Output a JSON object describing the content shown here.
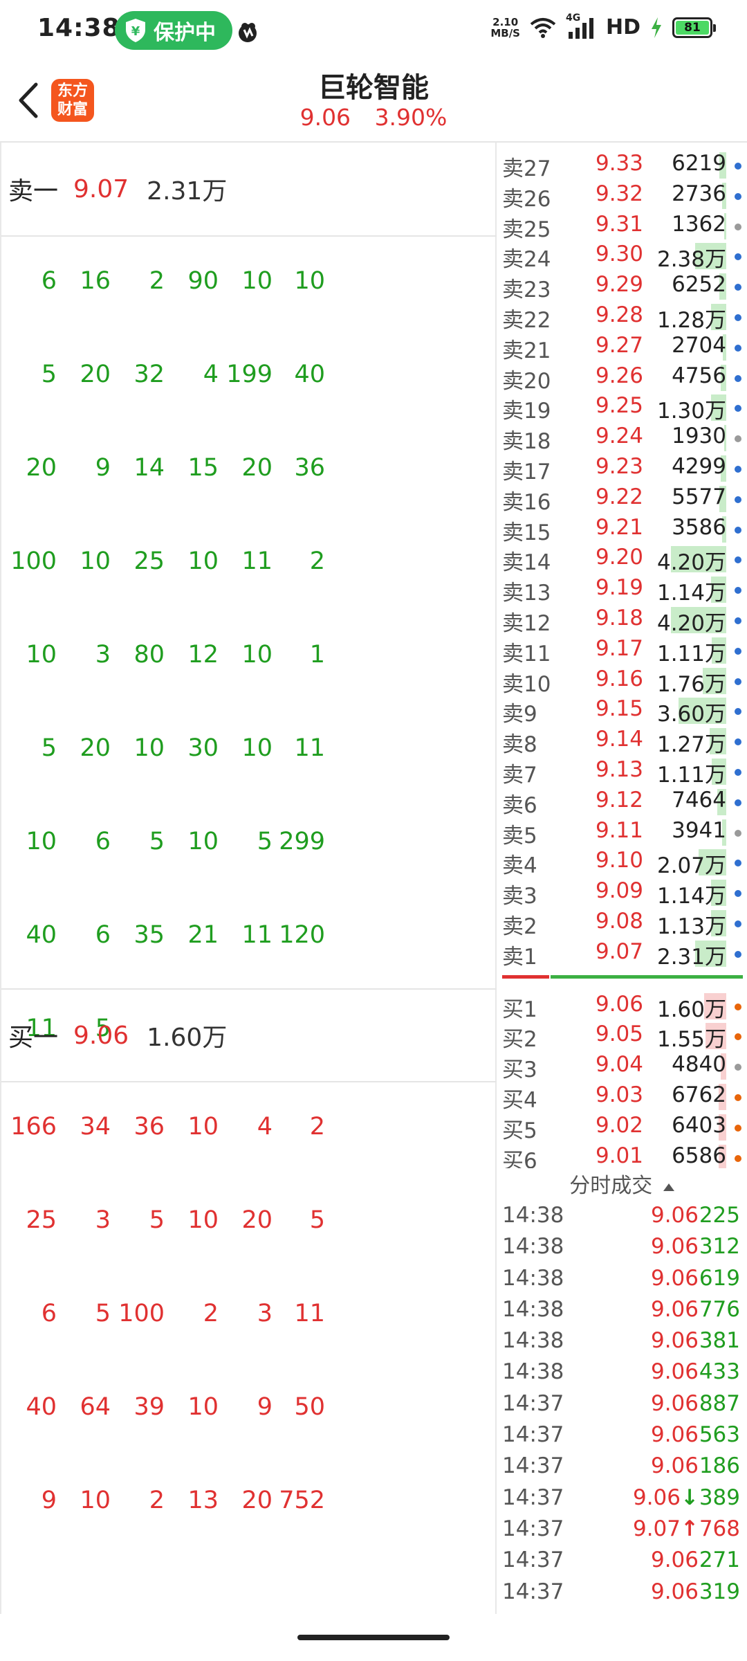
{
  "status": {
    "time": "14:38",
    "protect_label": "保护中",
    "net_speed_value": "2.10",
    "net_speed_unit": "MB/S",
    "network": "4G",
    "hd": "HD",
    "battery": "81"
  },
  "header": {
    "logo_line1": "东方",
    "logo_line2": "财富",
    "stock_name": "巨轮智能",
    "price": "9.06",
    "change_pct": "3.90%"
  },
  "sell_summary": {
    "label": "卖一",
    "price": "9.07",
    "volume": "2.31万"
  },
  "sell_queue": [
    [
      "6",
      "16",
      "2",
      "90",
      "10",
      "10"
    ],
    [
      "5",
      "20",
      "32",
      "4",
      "199",
      "40"
    ],
    [
      "20",
      "9",
      "14",
      "15",
      "20",
      "36"
    ],
    [
      "100",
      "10",
      "25",
      "10",
      "11",
      "2"
    ],
    [
      "10",
      "3",
      "80",
      "12",
      "10",
      "1"
    ],
    [
      "5",
      "20",
      "10",
      "30",
      "10",
      "11"
    ],
    [
      "10",
      "6",
      "5",
      "10",
      "5",
      "299"
    ],
    [
      "40",
      "6",
      "35",
      "21",
      "11",
      "120"
    ],
    [
      "11",
      "5",
      "",
      "",
      "",
      ""
    ]
  ],
  "buy_summary": {
    "label": "买一",
    "price": "9.06",
    "volume": "1.60万"
  },
  "buy_queue": [
    [
      "166",
      "34",
      "36",
      "10",
      "4",
      "2"
    ],
    [
      "25",
      "3",
      "5",
      "10",
      "20",
      "5"
    ],
    [
      "6",
      "5",
      "100",
      "2",
      "3",
      "11"
    ],
    [
      "40",
      "64",
      "39",
      "10",
      "9",
      "50"
    ],
    [
      "9",
      "10",
      "2",
      "13",
      "20",
      "752"
    ]
  ],
  "order_book": {
    "asks": [
      {
        "label": "卖27",
        "price": "9.33",
        "volume": "6219",
        "bar": 0.06,
        "dot": "blue"
      },
      {
        "label": "卖26",
        "price": "9.32",
        "volume": "2736",
        "bar": 0.04,
        "dot": "blue"
      },
      {
        "label": "卖25",
        "price": "9.31",
        "volume": "1362",
        "bar": 0.02,
        "dot": "gray"
      },
      {
        "label": "卖24",
        "price": "9.30",
        "volume": "2.38万",
        "bar": 0.28,
        "dot": "blue"
      },
      {
        "label": "卖23",
        "price": "9.29",
        "volume": "6252",
        "bar": 0.06,
        "dot": "blue"
      },
      {
        "label": "卖22",
        "price": "9.28",
        "volume": "1.28万",
        "bar": 0.14,
        "dot": "blue"
      },
      {
        "label": "卖21",
        "price": "9.27",
        "volume": "2704",
        "bar": 0.03,
        "dot": "blue"
      },
      {
        "label": "卖20",
        "price": "9.26",
        "volume": "4756",
        "bar": 0.05,
        "dot": "blue"
      },
      {
        "label": "卖19",
        "price": "9.25",
        "volume": "1.30万",
        "bar": 0.14,
        "dot": "blue"
      },
      {
        "label": "卖18",
        "price": "9.24",
        "volume": "1930",
        "bar": 0.02,
        "dot": "gray"
      },
      {
        "label": "卖17",
        "price": "9.23",
        "volume": "4299",
        "bar": 0.05,
        "dot": "blue"
      },
      {
        "label": "卖16",
        "price": "9.22",
        "volume": "5577",
        "bar": 0.06,
        "dot": "blue"
      },
      {
        "label": "卖15",
        "price": "9.21",
        "volume": "3586",
        "bar": 0.04,
        "dot": "blue"
      },
      {
        "label": "卖14",
        "price": "9.20",
        "volume": "4.20万",
        "bar": 0.5,
        "dot": "blue"
      },
      {
        "label": "卖13",
        "price": "9.19",
        "volume": "1.14万",
        "bar": 0.14,
        "dot": "blue"
      },
      {
        "label": "卖12",
        "price": "9.18",
        "volume": "4.20万",
        "bar": 0.5,
        "dot": "blue"
      },
      {
        "label": "卖11",
        "price": "9.17",
        "volume": "1.11万",
        "bar": 0.13,
        "dot": "blue"
      },
      {
        "label": "卖10",
        "price": "9.16",
        "volume": "1.76万",
        "bar": 0.21,
        "dot": "blue"
      },
      {
        "label": "卖9",
        "price": "9.15",
        "volume": "3.60万",
        "bar": 0.43,
        "dot": "blue"
      },
      {
        "label": "卖8",
        "price": "9.14",
        "volume": "1.27万",
        "bar": 0.15,
        "dot": "blue"
      },
      {
        "label": "卖7",
        "price": "9.13",
        "volume": "1.11万",
        "bar": 0.13,
        "dot": "blue"
      },
      {
        "label": "卖6",
        "price": "9.12",
        "volume": "7464",
        "bar": 0.08,
        "dot": "blue"
      },
      {
        "label": "卖5",
        "price": "9.11",
        "volume": "3941",
        "bar": 0.04,
        "dot": "gray"
      },
      {
        "label": "卖4",
        "price": "9.10",
        "volume": "2.07万",
        "bar": 0.25,
        "dot": "blue"
      },
      {
        "label": "卖3",
        "price": "9.09",
        "volume": "1.14万",
        "bar": 0.14,
        "dot": "blue"
      },
      {
        "label": "卖2",
        "price": "9.08",
        "volume": "1.13万",
        "bar": 0.14,
        "dot": "blue"
      },
      {
        "label": "卖1",
        "price": "9.07",
        "volume": "2.31万",
        "bar": 0.28,
        "dot": "blue"
      }
    ],
    "bids": [
      {
        "label": "买1",
        "price": "9.06",
        "volume": "1.60万",
        "bar": 0.2,
        "dot": "orange"
      },
      {
        "label": "买2",
        "price": "9.05",
        "volume": "1.55万",
        "bar": 0.19,
        "dot": "orange"
      },
      {
        "label": "买3",
        "price": "9.04",
        "volume": "4840",
        "bar": 0.05,
        "dot": "gray"
      },
      {
        "label": "买4",
        "price": "9.03",
        "volume": "6762",
        "bar": 0.07,
        "dot": "orange"
      },
      {
        "label": "买5",
        "price": "9.02",
        "volume": "6403",
        "bar": 0.07,
        "dot": "orange"
      },
      {
        "label": "买6",
        "price": "9.01",
        "volume": "6586",
        "bar": 0.07,
        "dot": "orange"
      }
    ]
  },
  "trades_title": "分时成交",
  "trades": [
    {
      "time": "14:38",
      "price": "9.06",
      "volume": "225",
      "color": "green",
      "arrow": ""
    },
    {
      "time": "14:38",
      "price": "9.06",
      "volume": "312",
      "color": "green",
      "arrow": ""
    },
    {
      "time": "14:38",
      "price": "9.06",
      "volume": "619",
      "color": "green",
      "arrow": ""
    },
    {
      "time": "14:38",
      "price": "9.06",
      "volume": "776",
      "color": "green",
      "arrow": ""
    },
    {
      "time": "14:38",
      "price": "9.06",
      "volume": "381",
      "color": "green",
      "arrow": ""
    },
    {
      "time": "14:38",
      "price": "9.06",
      "volume": "433",
      "color": "green",
      "arrow": ""
    },
    {
      "time": "14:37",
      "price": "9.06",
      "volume": "887",
      "color": "green",
      "arrow": ""
    },
    {
      "time": "14:37",
      "price": "9.06",
      "volume": "563",
      "color": "green",
      "arrow": ""
    },
    {
      "time": "14:37",
      "price": "9.06",
      "volume": "186",
      "color": "green",
      "arrow": ""
    },
    {
      "time": "14:37",
      "price": "9.06",
      "volume": "389",
      "color": "green",
      "arrow": "↓"
    },
    {
      "time": "14:37",
      "price": "9.07",
      "volume": "768",
      "color": "red",
      "arrow": "↑"
    },
    {
      "time": "14:37",
      "price": "9.06",
      "volume": "271",
      "color": "green",
      "arrow": ""
    },
    {
      "time": "14:37",
      "price": "9.06",
      "volume": "319",
      "color": "green",
      "arrow": ""
    }
  ]
}
